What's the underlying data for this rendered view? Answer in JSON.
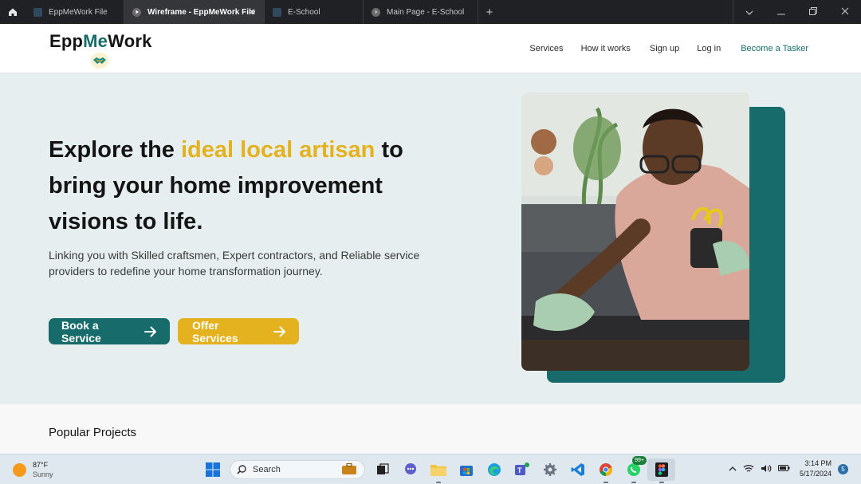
{
  "browser": {
    "tabs": [
      {
        "label": "EppMeWork File",
        "active": false
      },
      {
        "label": "Wireframe - EppMeWork File",
        "active": true
      },
      {
        "label": "E-School",
        "active": false
      },
      {
        "label": "Main Page - E-School",
        "active": false
      }
    ],
    "close_symbol": "✕",
    "new_tab_symbol": "+"
  },
  "site": {
    "logo_prefix": "Epp",
    "logo_highlight": "Me",
    "logo_suffix": "Work",
    "nav": [
      "Services",
      "How it works",
      "Sign up",
      "Log in",
      "Become a Tasker"
    ],
    "brand_color": "#176b6b",
    "accent_color": "#e3b21e"
  },
  "hero": {
    "headline_part1": "Explore the ",
    "headline_highlight": "ideal local artisan",
    "headline_part2": " to bring your home improvement visions to life.",
    "subtext": "Linking you with Skilled craftsmen, Expert contractors, and Reliable service providers to redefine your home transformation journey.",
    "book_button": "Book a Service",
    "offer_button": "Offer Services"
  },
  "popular": {
    "title": "Popular Projects"
  },
  "taskbar": {
    "temperature": "87°F",
    "condition": "Sunny",
    "search_placeholder": "Search",
    "whatsapp_badge": "99+",
    "time": "3:14 PM",
    "date": "5/17/2024",
    "notification_count": "5"
  }
}
